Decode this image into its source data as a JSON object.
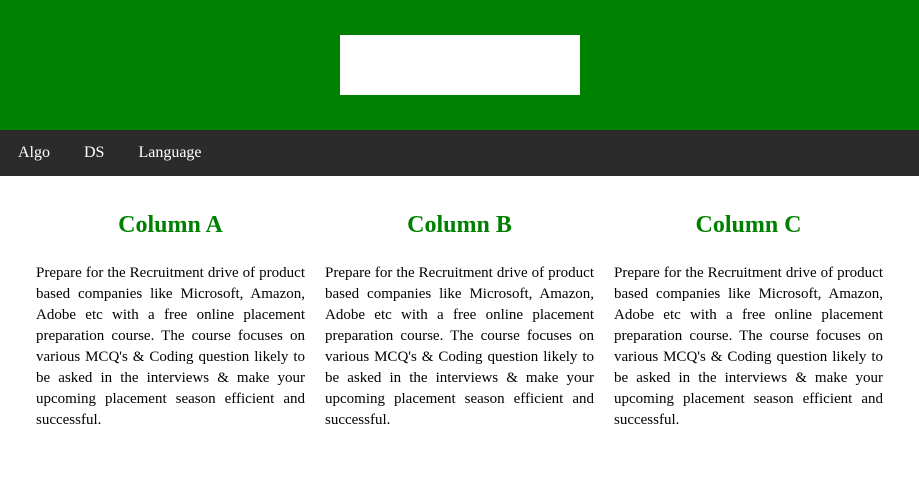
{
  "nav": {
    "items": [
      "Algo",
      "DS",
      "Language"
    ]
  },
  "columns": [
    {
      "title": "Column A",
      "body": "Prepare for the Recruitment drive of product based companies like Microsoft, Amazon, Adobe etc with a free online placement preparation course. The course focuses on various MCQ's & Coding question likely to be asked in the interviews & make your upcoming placement season efficient and successful."
    },
    {
      "title": "Column B",
      "body": "Prepare for the Recruitment drive of product based companies like Microsoft, Amazon, Adobe etc with a free online placement preparation course. The course focuses on various MCQ's & Coding question likely to be asked in the interviews & make your upcoming placement season efficient and successful."
    },
    {
      "title": "Column C",
      "body": "Prepare for the Recruitment drive of product based companies like Microsoft, Amazon, Adobe etc with a free online placement preparation course. The course focuses on various MCQ's & Coding question likely to be asked in the interviews & make your upcoming placement season efficient and successful."
    }
  ]
}
